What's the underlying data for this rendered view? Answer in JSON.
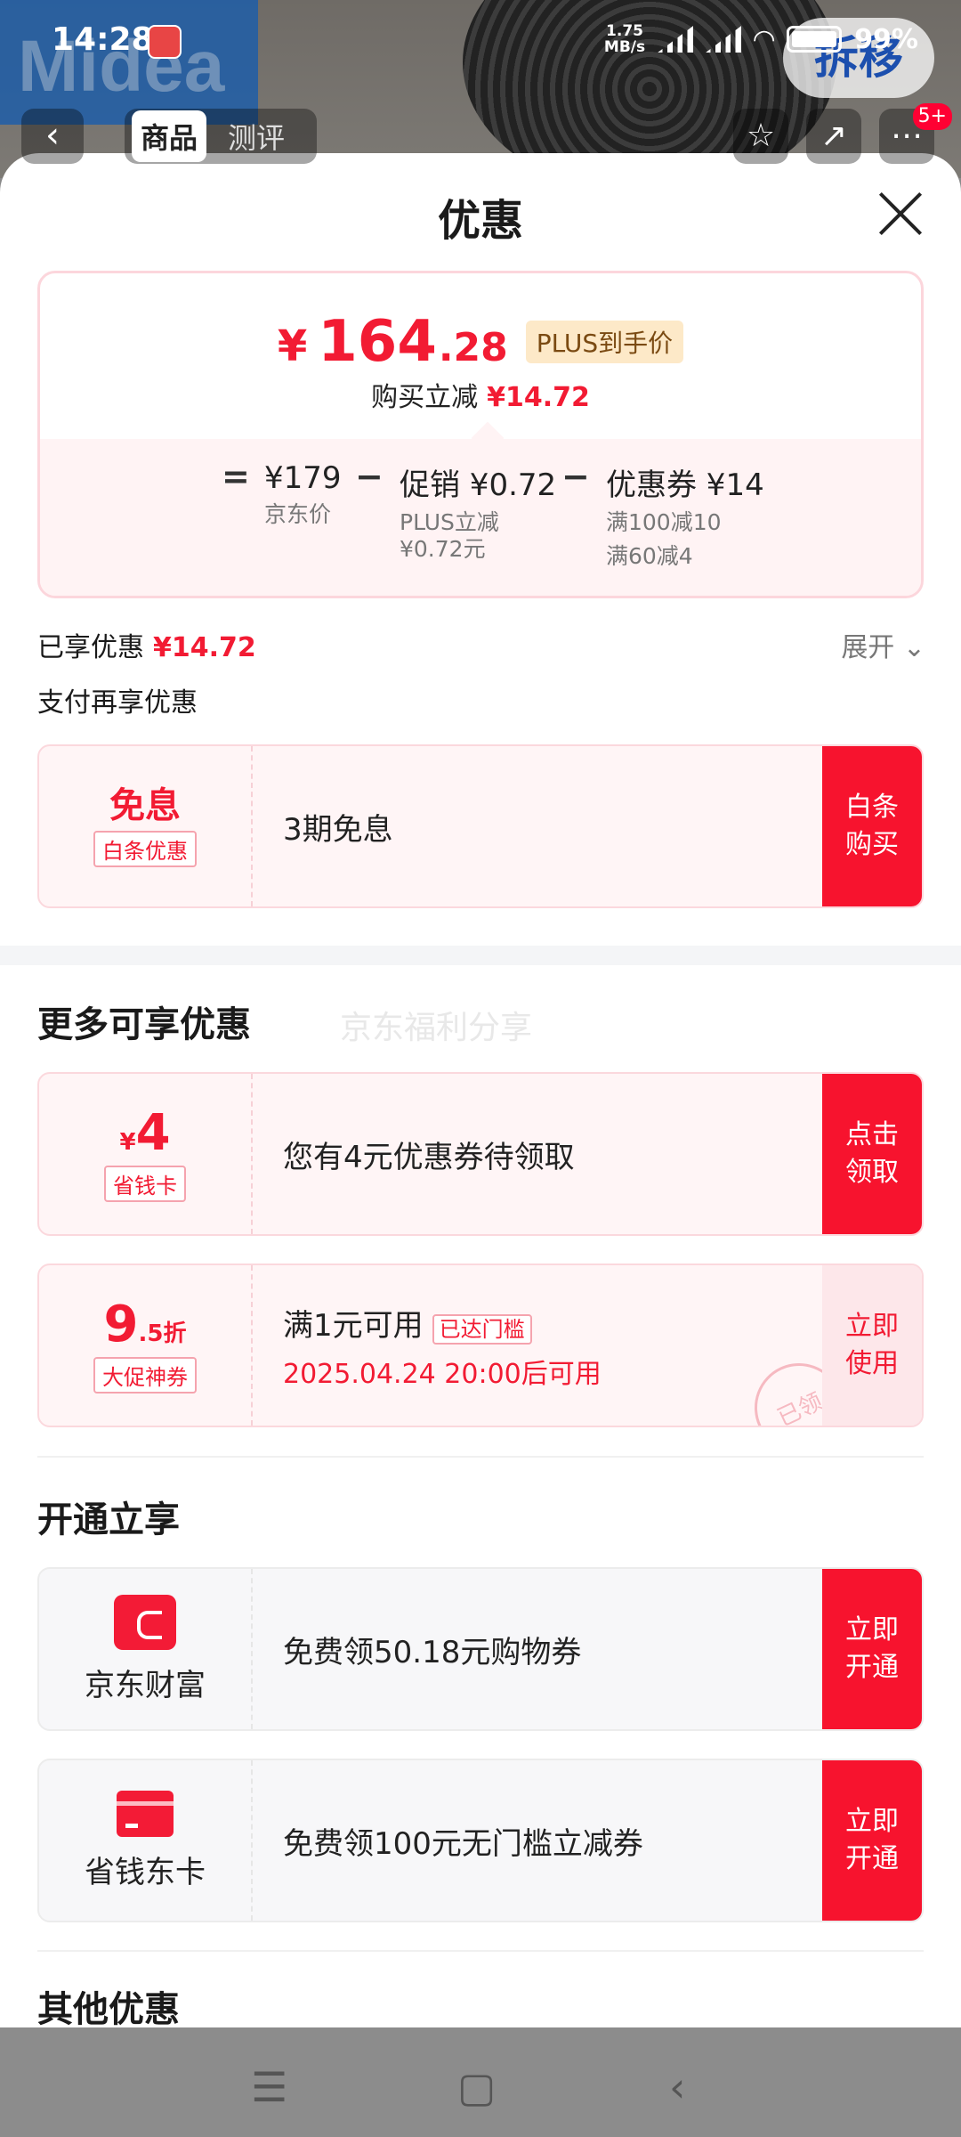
{
  "status_bar": {
    "time": "14:28",
    "net_speed_top": "1.75",
    "net_speed_bottom": "MB/s",
    "battery": "99%"
  },
  "background": {
    "brand": "Midea",
    "promo_badge": "拆移"
  },
  "product_nav": {
    "tabs": [
      "商品",
      "测评"
    ],
    "cart_badge": "5+"
  },
  "sheet": {
    "title": "优惠",
    "price_card": {
      "currency": "¥",
      "price_int": "164",
      "price_dec": ".28",
      "plus_tag": "PLUS到手价",
      "reduce_label": "购买立减",
      "reduce_amount": "¥14.72",
      "breakdown": {
        "equals": "=",
        "minus": "−",
        "jd_price": "¥179",
        "jd_price_label": "京东价",
        "promo": "促销 ¥0.72",
        "promo_sub1": "PLUS立减",
        "promo_sub2": "¥0.72元",
        "coupon": "优惠券 ¥14",
        "coupon_sub1": "满100减10",
        "coupon_sub2": "满60减4"
      }
    },
    "enjoyed_label": "已享优惠",
    "enjoyed_amount": "¥14.72",
    "expand_label": "展开",
    "pay_again_label": "支付再享优惠",
    "baitiao": {
      "big": "免息",
      "tag": "白条优惠",
      "desc": "3期免息",
      "button": "白条购买"
    },
    "more_title": "更多可享优惠",
    "watermark": "京东福利分享",
    "saver_card": {
      "currency": "¥",
      "amount": "4",
      "tag": "省钱卡",
      "desc": "您有4元优惠券待领取",
      "button": "点击领取"
    },
    "promo_coupon": {
      "int": "9",
      "dec": ".5折",
      "tag": "大促神券",
      "desc": "满1元可用",
      "reached_tag": "已达门槛",
      "time": "2025.04.24 20:00后可用",
      "button": "立即使用",
      "stamp": "已领"
    },
    "open_title": "开通立享",
    "jd_finance": {
      "name": "京东财富",
      "desc": "免费领50.18元购物券",
      "button": "立即开通"
    },
    "saver_jd_card": {
      "name": "省钱东卡",
      "desc": "免费领100元无门槛立减券",
      "button": "立即开通"
    },
    "other_title": "其他优惠"
  },
  "colors": {
    "accent": "#f21b33",
    "button_red": "#f7132e",
    "plus_gold": "#fde9c8"
  }
}
